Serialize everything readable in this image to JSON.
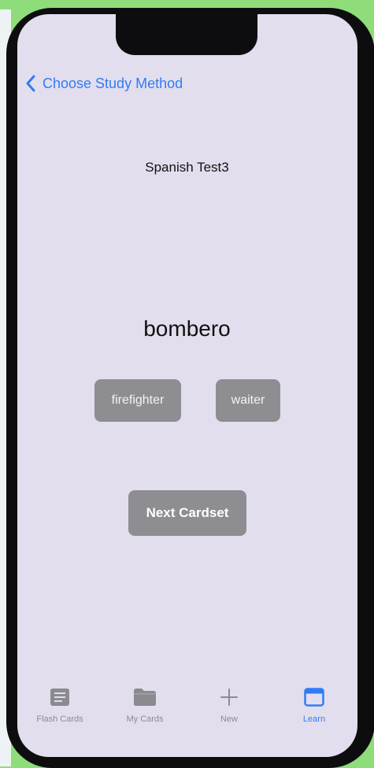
{
  "nav": {
    "back_label": "Choose Study Method"
  },
  "deck": {
    "title": "Spanish Test3"
  },
  "card": {
    "word": "bombero",
    "answers": [
      "firefighter",
      "waiter"
    ]
  },
  "actions": {
    "next_label": "Next Cardset"
  },
  "tabbar": {
    "items": [
      {
        "label": "Flash Cards",
        "icon": "flash-cards-icon"
      },
      {
        "label": "My Cards",
        "icon": "folder-icon"
      },
      {
        "label": "New",
        "icon": "plus-icon"
      },
      {
        "label": "Learn",
        "icon": "learn-icon",
        "active": true
      }
    ]
  },
  "colors": {
    "accent": "#2f7cf6",
    "screen_bg": "#e3deed",
    "button_bg": "#8e8d92"
  }
}
